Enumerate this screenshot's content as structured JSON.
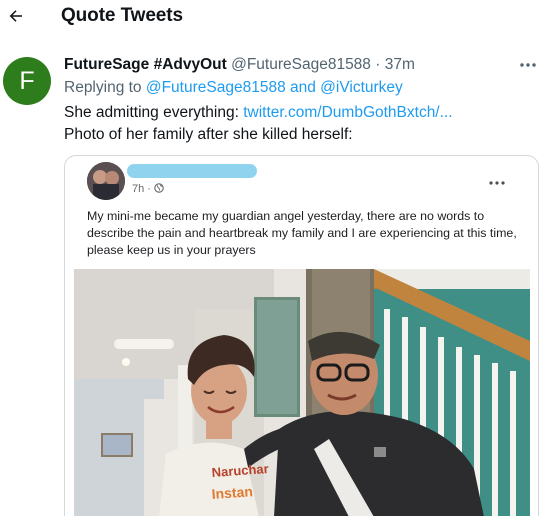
{
  "header": {
    "title": "Quote Tweets",
    "back_icon": "arrow-left-icon"
  },
  "tweet": {
    "avatar_letter": "F",
    "avatar_color": "#2e7d1d",
    "display_name": "FutureSage #AdvyOut",
    "handle": "@FutureSage81588",
    "separator": "·",
    "time": "37m",
    "more_icon": "more-icon",
    "reply_prefix": "Replying to",
    "reply_users": "@FutureSage81588 and @iVicturkey",
    "text_line1_prefix": "She admitting everything:",
    "text_link": "twitter.com/DumbGothBxtch/...",
    "text_line2": "Photo of her family after she killed herself:"
  },
  "quoted_post": {
    "time": "7h ·",
    "globe_icon": "globe-icon",
    "more_icon": "more-icon",
    "text": "My mini-me became my guardian angel yesterday, there are no words to describe the pain and heartbreak my family and I are experiencing at this time, please keep us in your prayers",
    "photo_shirt_text_1": "Naruchar",
    "photo_shirt_text_2": "Instan"
  },
  "colors": {
    "accent": "#1d9bf0",
    "secondary_text": "#536471",
    "redaction": "#8fd3ef"
  }
}
